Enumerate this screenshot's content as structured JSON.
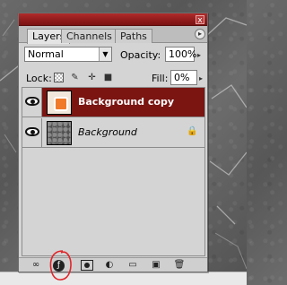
{
  "panel": {
    "close_label": "x",
    "menu_icon": "▸"
  },
  "tabs": [
    {
      "label": "Layers",
      "active": true
    },
    {
      "label": "Channels",
      "active": false
    },
    {
      "label": "Paths",
      "active": false
    }
  ],
  "blend_mode": "Normal",
  "opacity": {
    "label": "Opacity:",
    "value": "100%"
  },
  "lock": {
    "label": "Lock:"
  },
  "fill": {
    "label": "Fill:",
    "value": "0%"
  },
  "layers": [
    {
      "name": "Background copy",
      "selected": true,
      "visible": true
    },
    {
      "name": "Background",
      "selected": false,
      "visible": true,
      "locked": true
    }
  ],
  "toolbar_icons": [
    "link-icon",
    "fx-icon",
    "mask-icon",
    "adjustment-icon",
    "group-icon",
    "new-layer-icon",
    "delete-icon"
  ],
  "colors": {
    "titlebar": "#8f1a1a",
    "selected_layer": "#7a1512",
    "annotation": "#e0262a"
  }
}
